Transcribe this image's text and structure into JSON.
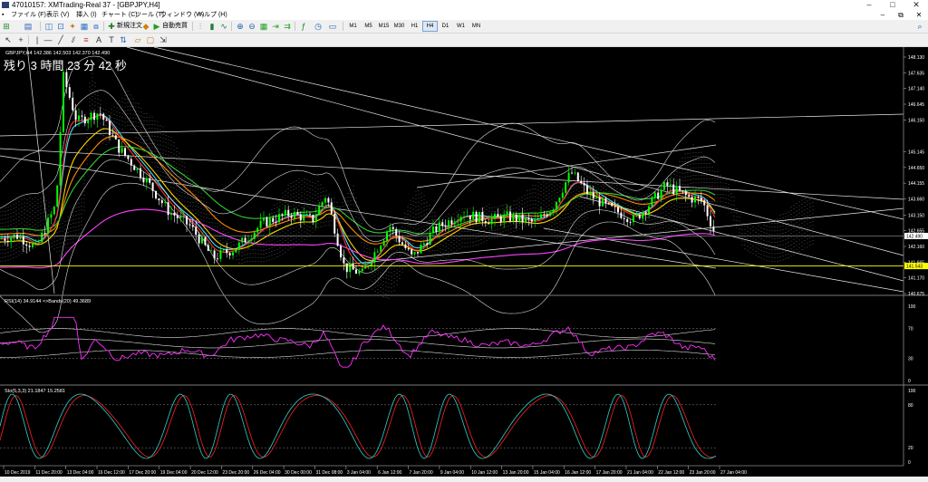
{
  "window": {
    "title": "47010157: XMTrading-Real 37 - [GBPJPY,H4]",
    "minimize": "–",
    "maximize": "□",
    "close": "✕"
  },
  "menu": {
    "items": [
      "ファイル (F)",
      "表示 (V)",
      "挿入 (I)",
      "チャート (C)",
      "ツール (T)",
      "ウィンドウ (W)",
      "ヘルプ (H)"
    ],
    "mdi": [
      "–",
      "⧉",
      "✕"
    ]
  },
  "toolbar": {
    "new_order": "新規注文",
    "auto_trading": "自動売買",
    "timeframes": [
      "M1",
      "M5",
      "M15",
      "M30",
      "H1",
      "H4",
      "D1",
      "W1",
      "MN"
    ],
    "active_timeframe": "H4"
  },
  "chart": {
    "symbol_info": "GBPJPY,H4  142.386 142.503 142.370 142.490",
    "countdown": "残り 3 時間 23 分 42 秒",
    "bid_price": "142.490",
    "hline_price": "141.543",
    "price_ticks": [
      "148.130",
      "147.635",
      "147.140",
      "146.645",
      "146.150",
      "145.145",
      "144.650",
      "144.155",
      "143.660",
      "143.150",
      "142.655",
      "142.160",
      "141.665",
      "141.170",
      "140.675"
    ],
    "time_ticks": [
      "10 Dec 2019",
      "11 Dec 20:00",
      "13 Dec 04:00",
      "16 Dec 12:00",
      "17 Dec 20:00",
      "19 Dec 04:00",
      "20 Dec 12:00",
      "23 Dec 20:00",
      "26 Dec 04:00",
      "30 Dec 00:00",
      "31 Dec 08:00",
      "3 Jan 04:00",
      "6 Jan 12:00",
      "7 Jan 20:00",
      "9 Jan 04:00",
      "10 Jan 12:00",
      "13 Jan 20:00",
      "15 Jan 04:00",
      "16 Jan 12:00",
      "17 Jan 20:00",
      "21 Jan 04:00",
      "22 Jan 12:00",
      "23 Jan 20:00",
      "27 Jan 04:00"
    ]
  },
  "rsi": {
    "label": "RSI(14) 34.9144  ×>Bands(20) 49.3689",
    "ticks": [
      "100",
      "70",
      "30",
      "0"
    ]
  },
  "stoch": {
    "label": "Sto(5,3,3) 21.1847 15.2581",
    "ticks": [
      "100",
      "80",
      "20",
      "0"
    ]
  },
  "colors": {
    "bull": "#00ff00",
    "bear": "#ffffff",
    "ma_cyan": "#40e0ff",
    "ma_yellow": "#ffd700",
    "ma_orange": "#ff8c00",
    "ma_green": "#32cd32",
    "ma_magenta": "#ff40ff",
    "ma_red": "#ff3030",
    "stoch_main": "#30d0d0",
    "stoch_signal": "#ff2020",
    "rsi_line": "#ff30ff",
    "hline": "#ffff00"
  }
}
